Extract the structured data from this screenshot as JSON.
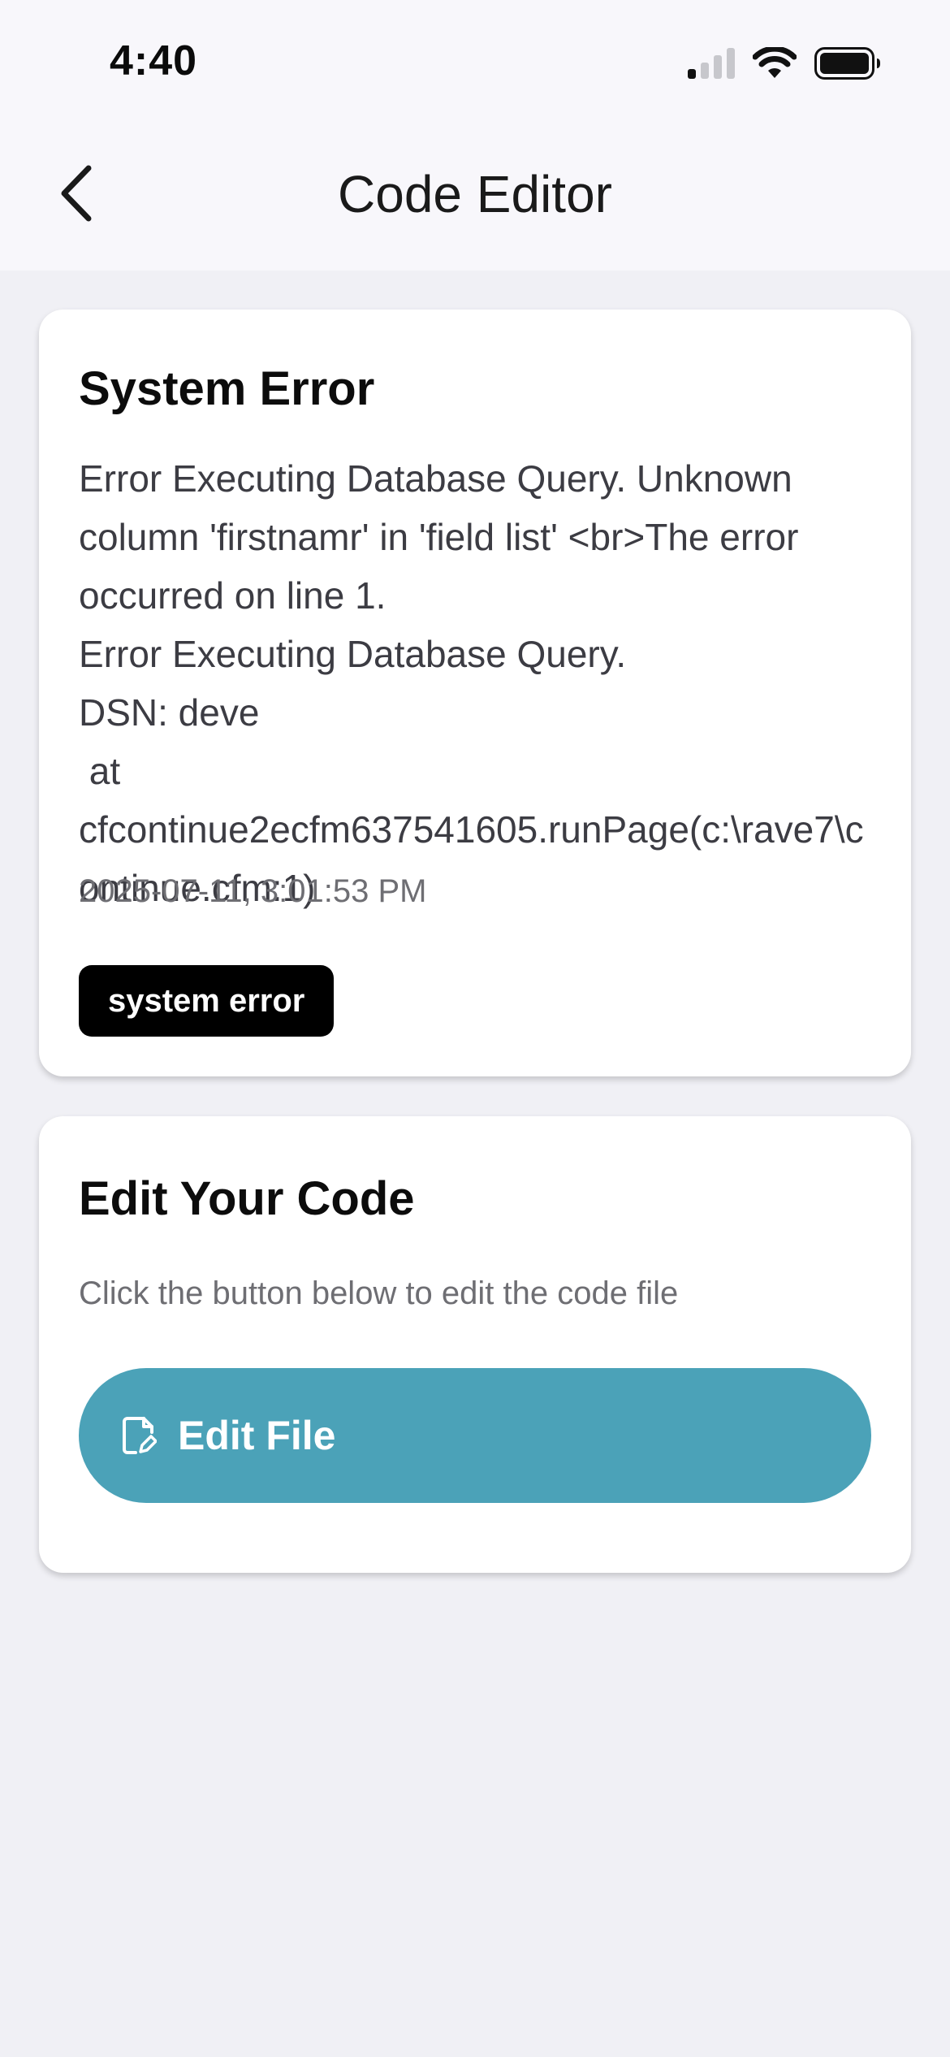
{
  "status_bar": {
    "time": "4:40",
    "icons": [
      "cellular-signal-icon",
      "wifi-icon",
      "battery-icon"
    ]
  },
  "nav": {
    "back_icon": "chevron-left-icon",
    "title": "Code Editor"
  },
  "error_card": {
    "title": "System Error",
    "message": "Error Executing Database Query. Unknown column 'firstnamr' in 'field list' <br>The error occurred on line 1.\nError Executing Database Query.\nDSN: deve\n at cfcontinue2ecfm637541605.runPage(c:\\rave7\\continue.cfm:1)",
    "timestamp": "2025-07-11, 3:01:53 PM",
    "badge": "system error"
  },
  "edit_card": {
    "title": "Edit Your Code",
    "description": "Click the button below to edit the code file",
    "button_label": "Edit File",
    "button_icon": "edit-file-icon"
  },
  "colors": {
    "page_background": "#f0f0f5",
    "header_background": "#f8f7fb",
    "accent_button": "#4ba2b8",
    "badge_background": "#000000"
  }
}
